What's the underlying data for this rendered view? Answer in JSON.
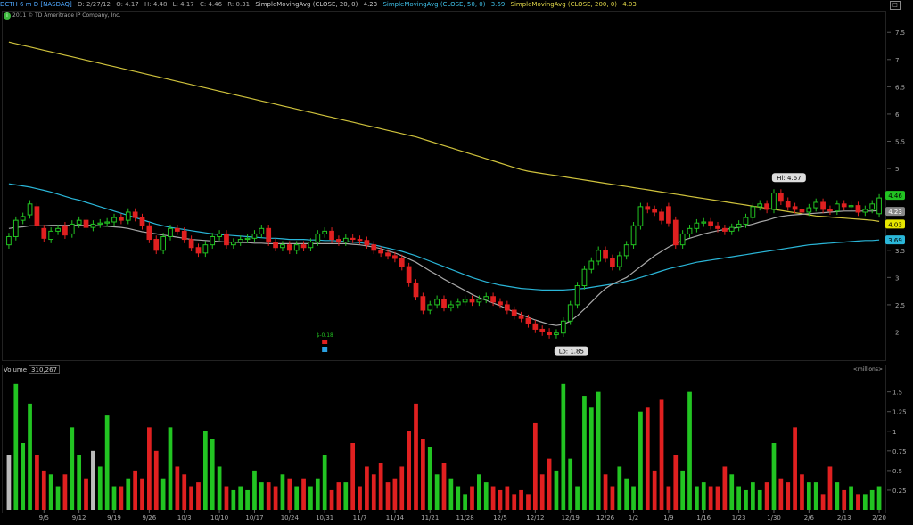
{
  "header": {
    "symbol": "DCTH 6 m D [NASDAQ]",
    "ohlc": {
      "date": "D: 2/27/12",
      "open": "O: 4.17",
      "high": "H: 4.48",
      "low": "L: 4.17",
      "close": "C: 4.46",
      "range": "R: 0.31"
    },
    "sma20": {
      "label": "SimpleMovingAvg (CLOSE, 20, 0)",
      "value": "4.23"
    },
    "sma50": {
      "label": "SimpleMovingAvg (CLOSE, 50, 0)",
      "value": "3.69"
    },
    "sma200": {
      "label": "SimpleMovingAvg (CLOSE, 200, 0)",
      "value": "4.03"
    },
    "copyright": "2011 © TD Ameritrade IP Company, Inc.",
    "copyright_glyph": "i"
  },
  "colors": {
    "up": "#22c422",
    "down": "#e02020",
    "sma20": "#a9a9a9",
    "sma50": "#2ab6d8",
    "sma200": "#cfc23c",
    "last": "#22c422"
  },
  "price_axis": {
    "ticks": [
      "7.5",
      "7",
      "6.5",
      "6",
      "5.5",
      "5",
      "4.5",
      "4",
      "3.5",
      "3",
      "2.5",
      "2"
    ],
    "tick_values": [
      7.5,
      7,
      6.5,
      6,
      5.5,
      5,
      4.5,
      4,
      3.5,
      3,
      2.5,
      2
    ],
    "min": 1.55,
    "max": 7.7
  },
  "labels": {
    "last": "4.46",
    "sma20_tag": "4.23",
    "sma200_tag": "4.03",
    "sma50_tag": "3.69",
    "hi": "Hi: 4.67",
    "lo": "Lo: 1.85",
    "event": "$-0.18",
    "win": "□"
  },
  "volume": {
    "label": "Volume",
    "value": "310,267",
    "unit": "<millions>",
    "ticks": [
      "1.5",
      "1.25",
      "1",
      "0.75",
      "0.5",
      "0.25"
    ],
    "tick_values": [
      1.5,
      1.25,
      1,
      0.75,
      0.5,
      0.25
    ],
    "max": 1.7
  },
  "x_labels": [
    "9/5",
    "9/12",
    "9/19",
    "9/26",
    "10/3",
    "10/10",
    "10/17",
    "10/24",
    "10/31",
    "11/7",
    "11/14",
    "11/21",
    "11/28",
    "12/5",
    "12/12",
    "12/19",
    "12/26",
    "1/2",
    "1/9",
    "1/16",
    "1/23",
    "1/30",
    "2/6",
    "2/13",
    "2/20"
  ],
  "x_label_index": [
    5,
    10,
    15,
    20,
    25,
    30,
    35,
    40,
    45,
    50,
    55,
    60,
    65,
    70,
    75,
    80,
    85,
    89,
    94,
    99,
    104,
    109,
    114,
    119,
    124
  ],
  "chart_data": {
    "type": "candlestick",
    "title": "DCTH 6 m D [NASDAQ]",
    "series_names": [
      "SimpleMovingAvg (CLOSE, 20, 0)",
      "SimpleMovingAvg (CLOSE, 50, 0)",
      "SimpleMovingAvg (CLOSE, 200, 0)",
      "Volume"
    ],
    "closes": [
      3.75,
      4.05,
      4.12,
      4.35,
      3.95,
      3.72,
      3.85,
      3.9,
      3.78,
      3.98,
      4.05,
      3.92,
      3.98,
      4.0,
      4.02,
      4.1,
      4.05,
      4.2,
      4.1,
      3.95,
      3.7,
      3.5,
      3.75,
      3.9,
      3.85,
      3.7,
      3.55,
      3.45,
      3.6,
      3.75,
      3.8,
      3.6,
      3.65,
      3.7,
      3.72,
      3.8,
      3.9,
      3.65,
      3.55,
      3.6,
      3.5,
      3.6,
      3.55,
      3.65,
      3.8,
      3.85,
      3.7,
      3.65,
      3.72,
      3.7,
      3.68,
      3.6,
      3.5,
      3.45,
      3.4,
      3.35,
      3.2,
      2.9,
      2.65,
      2.4,
      2.5,
      2.6,
      2.45,
      2.5,
      2.55,
      2.6,
      2.55,
      2.6,
      2.65,
      2.55,
      2.5,
      2.4,
      2.3,
      2.25,
      2.15,
      2.05,
      2.0,
      1.95,
      1.98,
      2.2,
      2.5,
      2.85,
      3.15,
      3.3,
      3.5,
      3.35,
      3.2,
      3.4,
      3.6,
      3.95,
      4.3,
      4.25,
      4.2,
      4.05,
      4.0,
      3.6,
      3.8,
      3.9,
      4.0,
      4.02,
      3.95,
      3.9,
      3.85,
      3.92,
      3.98,
      4.1,
      4.3,
      4.35,
      4.25,
      4.55,
      4.4,
      4.3,
      4.25,
      4.2,
      4.28,
      4.38,
      4.25,
      4.22,
      4.35,
      4.3,
      4.32,
      4.2,
      4.25,
      4.35,
      4.46
    ],
    "opens": [
      3.6,
      3.75,
      4.05,
      4.15,
      4.3,
      3.9,
      3.7,
      3.85,
      3.95,
      3.8,
      3.98,
      4.05,
      3.92,
      3.98,
      4.0,
      4.02,
      4.1,
      4.05,
      4.2,
      4.1,
      3.95,
      3.7,
      3.5,
      3.75,
      3.9,
      3.85,
      3.7,
      3.55,
      3.45,
      3.6,
      3.75,
      3.8,
      3.6,
      3.65,
      3.7,
      3.72,
      3.8,
      3.9,
      3.65,
      3.55,
      3.6,
      3.5,
      3.6,
      3.55,
      3.65,
      3.8,
      3.85,
      3.7,
      3.65,
      3.72,
      3.7,
      3.68,
      3.6,
      3.5,
      3.45,
      3.4,
      3.35,
      3.2,
      2.9,
      2.65,
      2.4,
      2.5,
      2.6,
      2.45,
      2.5,
      2.55,
      2.6,
      2.55,
      2.6,
      2.65,
      2.55,
      2.5,
      2.4,
      2.3,
      2.25,
      2.15,
      2.05,
      2.0,
      1.95,
      1.98,
      2.2,
      2.5,
      2.85,
      3.15,
      3.3,
      3.5,
      3.35,
      3.2,
      3.4,
      3.6,
      3.95,
      4.3,
      4.25,
      4.2,
      4.3,
      4.05,
      3.6,
      3.8,
      3.9,
      4.0,
      4.02,
      3.95,
      3.9,
      3.85,
      3.92,
      3.98,
      4.1,
      4.3,
      4.35,
      4.25,
      4.55,
      4.4,
      4.3,
      4.25,
      4.2,
      4.28,
      4.38,
      4.25,
      4.22,
      4.35,
      4.3,
      4.32,
      4.2,
      4.25,
      4.17
    ],
    "sma20": [
      3.9,
      3.92,
      3.93,
      3.95,
      3.95,
      3.95,
      3.96,
      3.96,
      3.96,
      3.96,
      3.96,
      3.96,
      3.96,
      3.95,
      3.94,
      3.93,
      3.92,
      3.9,
      3.87,
      3.84,
      3.82,
      3.8,
      3.78,
      3.76,
      3.74,
      3.72,
      3.7,
      3.69,
      3.68,
      3.67,
      3.66,
      3.65,
      3.65,
      3.64,
      3.64,
      3.63,
      3.63,
      3.62,
      3.62,
      3.62,
      3.62,
      3.62,
      3.62,
      3.62,
      3.62,
      3.62,
      3.62,
      3.62,
      3.62,
      3.61,
      3.6,
      3.58,
      3.56,
      3.53,
      3.49,
      3.45,
      3.4,
      3.34,
      3.28,
      3.2,
      3.12,
      3.05,
      2.97,
      2.9,
      2.83,
      2.76,
      2.69,
      2.63,
      2.58,
      2.53,
      2.48,
      2.42,
      2.37,
      2.32,
      2.27,
      2.22,
      2.18,
      2.14,
      2.12,
      2.14,
      2.2,
      2.3,
      2.42,
      2.55,
      2.68,
      2.8,
      2.88,
      2.94,
      3.0,
      3.1,
      3.2,
      3.3,
      3.4,
      3.48,
      3.56,
      3.62,
      3.68,
      3.72,
      3.76,
      3.8,
      3.83,
      3.86,
      3.88,
      3.9,
      3.92,
      3.95,
      3.98,
      4.02,
      4.05,
      4.09,
      4.12,
      4.14,
      4.15,
      4.16,
      4.17,
      4.18,
      4.19,
      4.2,
      4.21,
      4.22,
      4.22,
      4.22,
      4.22,
      4.22,
      4.23
    ],
    "sma50": [
      4.72,
      4.7,
      4.68,
      4.66,
      4.63,
      4.6,
      4.57,
      4.53,
      4.49,
      4.45,
      4.42,
      4.38,
      4.34,
      4.3,
      4.26,
      4.22,
      4.18,
      4.14,
      4.1,
      4.06,
      4.02,
      3.98,
      3.95,
      3.92,
      3.9,
      3.88,
      3.86,
      3.84,
      3.82,
      3.8,
      3.79,
      3.78,
      3.77,
      3.76,
      3.75,
      3.74,
      3.73,
      3.72,
      3.72,
      3.71,
      3.7,
      3.7,
      3.7,
      3.69,
      3.69,
      3.68,
      3.68,
      3.67,
      3.66,
      3.65,
      3.64,
      3.62,
      3.6,
      3.57,
      3.54,
      3.51,
      3.48,
      3.44,
      3.4,
      3.35,
      3.3,
      3.25,
      3.2,
      3.15,
      3.1,
      3.05,
      3.0,
      2.96,
      2.92,
      2.89,
      2.86,
      2.84,
      2.82,
      2.8,
      2.79,
      2.78,
      2.77,
      2.77,
      2.77,
      2.77,
      2.78,
      2.79,
      2.8,
      2.82,
      2.84,
      2.86,
      2.88,
      2.9,
      2.93,
      2.96,
      3.0,
      3.04,
      3.08,
      3.12,
      3.16,
      3.19,
      3.22,
      3.25,
      3.28,
      3.3,
      3.32,
      3.34,
      3.36,
      3.38,
      3.4,
      3.42,
      3.44,
      3.46,
      3.48,
      3.5,
      3.52,
      3.54,
      3.56,
      3.58,
      3.6,
      3.61,
      3.62,
      3.63,
      3.64,
      3.65,
      3.66,
      3.67,
      3.68,
      3.68,
      3.69
    ],
    "sma200": [
      7.32,
      7.29,
      7.26,
      7.23,
      7.2,
      7.17,
      7.14,
      7.11,
      7.08,
      7.05,
      7.02,
      6.99,
      6.96,
      6.93,
      6.9,
      6.87,
      6.84,
      6.81,
      6.78,
      6.75,
      6.72,
      6.69,
      6.66,
      6.63,
      6.6,
      6.57,
      6.54,
      6.51,
      6.48,
      6.45,
      6.42,
      6.39,
      6.36,
      6.33,
      6.3,
      6.27,
      6.24,
      6.21,
      6.18,
      6.15,
      6.12,
      6.09,
      6.06,
      6.03,
      6.0,
      5.97,
      5.94,
      5.91,
      5.88,
      5.85,
      5.82,
      5.79,
      5.76,
      5.73,
      5.7,
      5.67,
      5.64,
      5.61,
      5.58,
      5.54,
      5.5,
      5.46,
      5.42,
      5.38,
      5.34,
      5.3,
      5.26,
      5.22,
      5.18,
      5.14,
      5.1,
      5.06,
      5.02,
      4.98,
      4.95,
      4.93,
      4.91,
      4.89,
      4.87,
      4.85,
      4.83,
      4.81,
      4.79,
      4.77,
      4.75,
      4.73,
      4.71,
      4.69,
      4.67,
      4.65,
      4.63,
      4.61,
      4.59,
      4.57,
      4.55,
      4.53,
      4.51,
      4.49,
      4.47,
      4.45,
      4.43,
      4.41,
      4.39,
      4.37,
      4.35,
      4.33,
      4.31,
      4.29,
      4.27,
      4.25,
      4.23,
      4.21,
      4.19,
      4.17,
      4.15,
      4.13,
      4.12,
      4.11,
      4.1,
      4.09,
      4.08,
      4.07,
      4.06,
      4.05,
      4.03
    ],
    "volume": [
      0.7,
      1.6,
      0.85,
      1.35,
      0.7,
      0.5,
      0.45,
      0.3,
      0.45,
      1.05,
      0.7,
      0.4,
      0.75,
      0.55,
      1.2,
      0.3,
      0.3,
      0.4,
      0.5,
      0.4,
      1.05,
      0.75,
      0.4,
      1.05,
      0.55,
      0.45,
      0.3,
      0.35,
      1.0,
      0.9,
      0.55,
      0.3,
      0.25,
      0.3,
      0.25,
      0.5,
      0.35,
      0.35,
      0.3,
      0.45,
      0.4,
      0.3,
      0.4,
      0.3,
      0.4,
      0.7,
      0.25,
      0.35,
      0.35,
      0.85,
      0.3,
      0.55,
      0.45,
      0.6,
      0.35,
      0.4,
      0.55,
      1.0,
      1.35,
      0.9,
      0.8,
      0.45,
      0.6,
      0.4,
      0.3,
      0.2,
      0.3,
      0.45,
      0.35,
      0.3,
      0.25,
      0.3,
      0.2,
      0.25,
      0.2,
      1.1,
      0.45,
      0.65,
      0.5,
      1.6,
      0.65,
      0.3,
      1.45,
      1.3,
      1.5,
      0.45,
      0.3,
      0.55,
      0.4,
      0.3,
      1.25,
      1.3,
      0.5,
      1.4,
      0.3,
      0.7,
      0.5,
      1.5,
      0.3,
      0.35,
      0.3,
      0.3,
      0.55,
      0.45,
      0.3,
      0.25,
      0.35,
      0.25,
      0.35,
      0.85,
      0.4,
      0.35,
      1.05,
      0.45,
      0.35,
      0.35,
      0.2,
      0.55,
      0.35,
      0.25,
      0.3,
      0.2,
      0.2,
      0.25,
      0.3
    ],
    "hi": 4.67,
    "lo": 1.85,
    "hi_index": 110,
    "lo_index": 79,
    "event_index": 45
  }
}
